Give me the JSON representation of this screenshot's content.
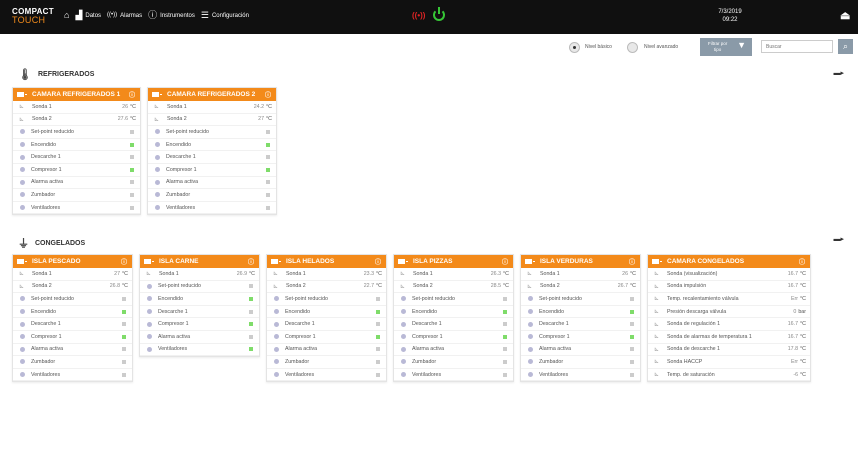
{
  "topbar": {
    "logo_line1": "COMPACT",
    "logo_line2": "TOUCH",
    "nav": [
      {
        "icon": "home-icon",
        "glyph": "⌂",
        "label": ""
      },
      {
        "icon": "chart-icon",
        "glyph": "▟",
        "label": "Datos"
      },
      {
        "icon": "signal-icon",
        "glyph": "((•))",
        "label": "Alarmas"
      },
      {
        "icon": "info-icon",
        "glyph": "ⓘ",
        "label": "Instrumentos"
      },
      {
        "icon": "sliders-icon",
        "glyph": "☰",
        "label": "Configuración"
      }
    ],
    "alarm_glyph": "((•))",
    "date": "7/3/2019",
    "time": "09:22",
    "logout_glyph": "⏏"
  },
  "toolbar": {
    "basic_level": "Nivel básico",
    "advanced_level": "Nivel avanzado",
    "filter_line1": "Filtrar por",
    "filter_line2": "tipo",
    "filter_glyph": "▼",
    "search_placeholder": "Buscar",
    "search_glyph": "⌕"
  },
  "sections": {
    "refrigerados": {
      "title": "REFRIGERADOS",
      "icon_glyph": "🌡",
      "end_glyph": "▬▸"
    },
    "congelados": {
      "title": "CONGELADOS",
      "icon_glyph": "⏚",
      "end_glyph": "▬▸"
    }
  },
  "colors": {
    "accent": "#f38a1a",
    "status_on": "#7fdc6a",
    "status_off": "#cccccc",
    "alarm": "#e02424",
    "power": "#36c736"
  },
  "cards": [
    {
      "name": "CAMARA REFRIGERADOS 1",
      "rows": [
        {
          "type": "sensor",
          "label": "Sonda 1",
          "value": "26",
          "unit": "°C"
        },
        {
          "type": "sensor",
          "label": "Sonda 2",
          "value": "27.6",
          "unit": "°C"
        },
        {
          "type": "status",
          "label": "Set-point reducido",
          "on": false
        },
        {
          "type": "status",
          "label": "Encendido",
          "on": true
        },
        {
          "type": "status",
          "label": "Descarche 1",
          "on": false
        },
        {
          "type": "status",
          "label": "Compresor 1",
          "on": true
        },
        {
          "type": "status",
          "label": "Alarma activa",
          "on": false
        },
        {
          "type": "status",
          "label": "Zumbador",
          "on": false
        },
        {
          "type": "status",
          "label": "Ventiladores",
          "on": false
        }
      ]
    },
    {
      "name": "CAMARA REFRIGERADOS 2",
      "rows": [
        {
          "type": "sensor",
          "label": "Sonda 1",
          "value": "24.2",
          "unit": "°C"
        },
        {
          "type": "sensor",
          "label": "Sonda 2",
          "value": "27",
          "unit": "°C"
        },
        {
          "type": "status",
          "label": "Set-point reducido",
          "on": false
        },
        {
          "type": "status",
          "label": "Encendido",
          "on": true
        },
        {
          "type": "status",
          "label": "Descarche 1",
          "on": false
        },
        {
          "type": "status",
          "label": "Compresor 1",
          "on": true
        },
        {
          "type": "status",
          "label": "Alarma activa",
          "on": false
        },
        {
          "type": "status",
          "label": "Zumbador",
          "on": false
        },
        {
          "type": "status",
          "label": "Ventiladores",
          "on": false
        }
      ]
    },
    {
      "name": "ISLA PESCADO",
      "rows": [
        {
          "type": "sensor",
          "label": "Sonda 1",
          "value": "27",
          "unit": "°C"
        },
        {
          "type": "sensor",
          "label": "Sonda 2",
          "value": "26.8",
          "unit": "°C"
        },
        {
          "type": "status",
          "label": "Set-point reducido",
          "on": false
        },
        {
          "type": "status",
          "label": "Encendido",
          "on": true
        },
        {
          "type": "status",
          "label": "Descarche 1",
          "on": false
        },
        {
          "type": "status",
          "label": "Compresor 1",
          "on": true
        },
        {
          "type": "status",
          "label": "Alarma activa",
          "on": false
        },
        {
          "type": "status",
          "label": "Zumbador",
          "on": false
        },
        {
          "type": "status",
          "label": "Ventiladores",
          "on": false
        }
      ]
    },
    {
      "name": "ISLA CARNE",
      "rows": [
        {
          "type": "sensor",
          "label": "Sonda 1",
          "value": "26.9",
          "unit": "°C"
        },
        {
          "type": "status",
          "label": "Set-point reducido",
          "on": false
        },
        {
          "type": "status",
          "label": "Encendido",
          "on": true
        },
        {
          "type": "status",
          "label": "Descarche 1",
          "on": false
        },
        {
          "type": "status",
          "label": "Compresor 1",
          "on": true
        },
        {
          "type": "status",
          "label": "Alarma activa",
          "on": false
        },
        {
          "type": "status",
          "label": "Ventiladores",
          "on": true
        }
      ]
    },
    {
      "name": "ISLA HELADOS",
      "rows": [
        {
          "type": "sensor",
          "label": "Sonda 1",
          "value": "23.3",
          "unit": "°C"
        },
        {
          "type": "sensor",
          "label": "Sonda 2",
          "value": "22.7",
          "unit": "°C"
        },
        {
          "type": "status",
          "label": "Set-point reducido",
          "on": false
        },
        {
          "type": "status",
          "label": "Encendido",
          "on": true
        },
        {
          "type": "status",
          "label": "Descarche 1",
          "on": false
        },
        {
          "type": "status",
          "label": "Compresor 1",
          "on": true
        },
        {
          "type": "status",
          "label": "Alarma activa",
          "on": false
        },
        {
          "type": "status",
          "label": "Zumbador",
          "on": false
        },
        {
          "type": "status",
          "label": "Ventiladores",
          "on": false
        }
      ]
    },
    {
      "name": "ISLA PIZZAS",
      "rows": [
        {
          "type": "sensor",
          "label": "Sonda 1",
          "value": "26.3",
          "unit": "°C"
        },
        {
          "type": "sensor",
          "label": "Sonda 2",
          "value": "28.5",
          "unit": "°C"
        },
        {
          "type": "status",
          "label": "Set-point reducido",
          "on": false
        },
        {
          "type": "status",
          "label": "Encendido",
          "on": true
        },
        {
          "type": "status",
          "label": "Descarche 1",
          "on": false
        },
        {
          "type": "status",
          "label": "Compresor 1",
          "on": true
        },
        {
          "type": "status",
          "label": "Alarma activa",
          "on": false
        },
        {
          "type": "status",
          "label": "Zumbador",
          "on": false
        },
        {
          "type": "status",
          "label": "Ventiladores",
          "on": false
        }
      ]
    },
    {
      "name": "ISLA VERDURAS",
      "rows": [
        {
          "type": "sensor",
          "label": "Sonda 1",
          "value": "26",
          "unit": "°C"
        },
        {
          "type": "sensor",
          "label": "Sonda 2",
          "value": "26.7",
          "unit": "°C"
        },
        {
          "type": "status",
          "label": "Set-point reducido",
          "on": false
        },
        {
          "type": "status",
          "label": "Encendido",
          "on": true
        },
        {
          "type": "status",
          "label": "Descarche 1",
          "on": false
        },
        {
          "type": "status",
          "label": "Compresor 1",
          "on": true
        },
        {
          "type": "status",
          "label": "Alarma activa",
          "on": false
        },
        {
          "type": "status",
          "label": "Zumbador",
          "on": false
        },
        {
          "type": "status",
          "label": "Ventiladores",
          "on": false
        }
      ]
    },
    {
      "name": "CAMARA CONGELADOS",
      "rows": [
        {
          "type": "sensor",
          "label": "Sonda (visualización)",
          "value": "16.7",
          "unit": "°C"
        },
        {
          "type": "sensor",
          "label": "Sonda impulsión",
          "value": "16.7",
          "unit": "°C"
        },
        {
          "type": "sensor",
          "label": "Temp. recalentamiento válvula",
          "value": "Err",
          "unit": "°C"
        },
        {
          "type": "sensor",
          "label": "Presión descarga válvula",
          "value": "0",
          "unit": "bar"
        },
        {
          "type": "sensor",
          "label": "Sonda de regulación 1",
          "value": "16.7",
          "unit": "°C"
        },
        {
          "type": "sensor",
          "label": "Sonda de alarmas de temperatura 1",
          "value": "16.7",
          "unit": "°C"
        },
        {
          "type": "sensor",
          "label": "Sonda de descarche 1",
          "value": "17.8",
          "unit": "°C"
        },
        {
          "type": "sensor",
          "label": "Sonda HACCP",
          "value": "Err",
          "unit": "°C"
        },
        {
          "type": "sensor",
          "label": "Temp. de saturación",
          "value": "-6",
          "unit": "°C"
        }
      ]
    }
  ]
}
